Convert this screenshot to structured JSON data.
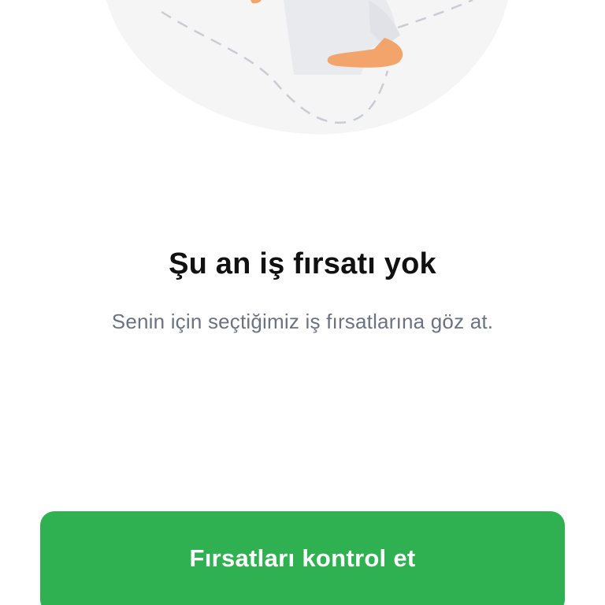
{
  "empty_state": {
    "title": "Şu an iş fırsatı yok",
    "subtitle": "Senin için seçtiğimiz iş fırsatlarına göz at."
  },
  "cta": {
    "label": "Fırsatları kontrol et"
  },
  "colors": {
    "accent": "#2fb152",
    "title": "#111111",
    "subtitle": "#6b7280",
    "illustration_bg": "#f5f5f6",
    "skin": "#f2a46b"
  },
  "illustration": {
    "icon": "person-illustration"
  }
}
